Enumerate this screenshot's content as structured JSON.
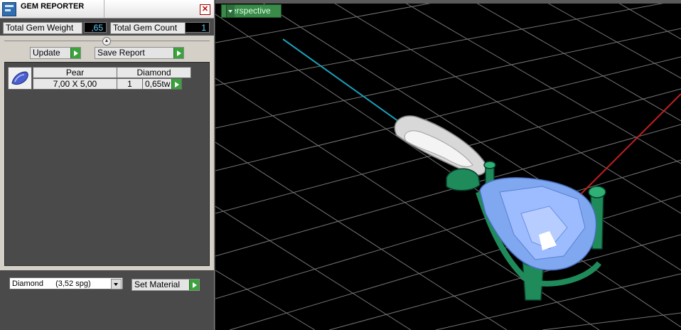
{
  "window": {
    "title": "GEM REPORTER",
    "close_icon": "close-icon"
  },
  "stats": {
    "weight_label": "Total Gem Weight",
    "weight_value": ",65",
    "count_label": "Total Gem Count",
    "count_value": "1"
  },
  "buttons": {
    "update": "Update",
    "save_report": "Save Report",
    "set_material": "Set Material"
  },
  "gem_list": {
    "headers": [
      "Pear",
      "Diamond"
    ],
    "rows": [
      {
        "size": "7,00 X 5,00",
        "count": "1",
        "weight": "0,65tw",
        "icon": "pear-gem-icon"
      }
    ]
  },
  "material": {
    "selected_name": "Diamond",
    "selected_spg": "(3,52 spg)"
  },
  "viewport": {
    "view_mode": "Perspective"
  },
  "colors": {
    "accent_green": "#3ca23c",
    "gem_blue": "#7fa8f0",
    "prong_green": "#1f8a5a",
    "grid": "#8a8a8a",
    "axis_y": "#1aa0b8",
    "axis_x": "#c81e1e"
  }
}
